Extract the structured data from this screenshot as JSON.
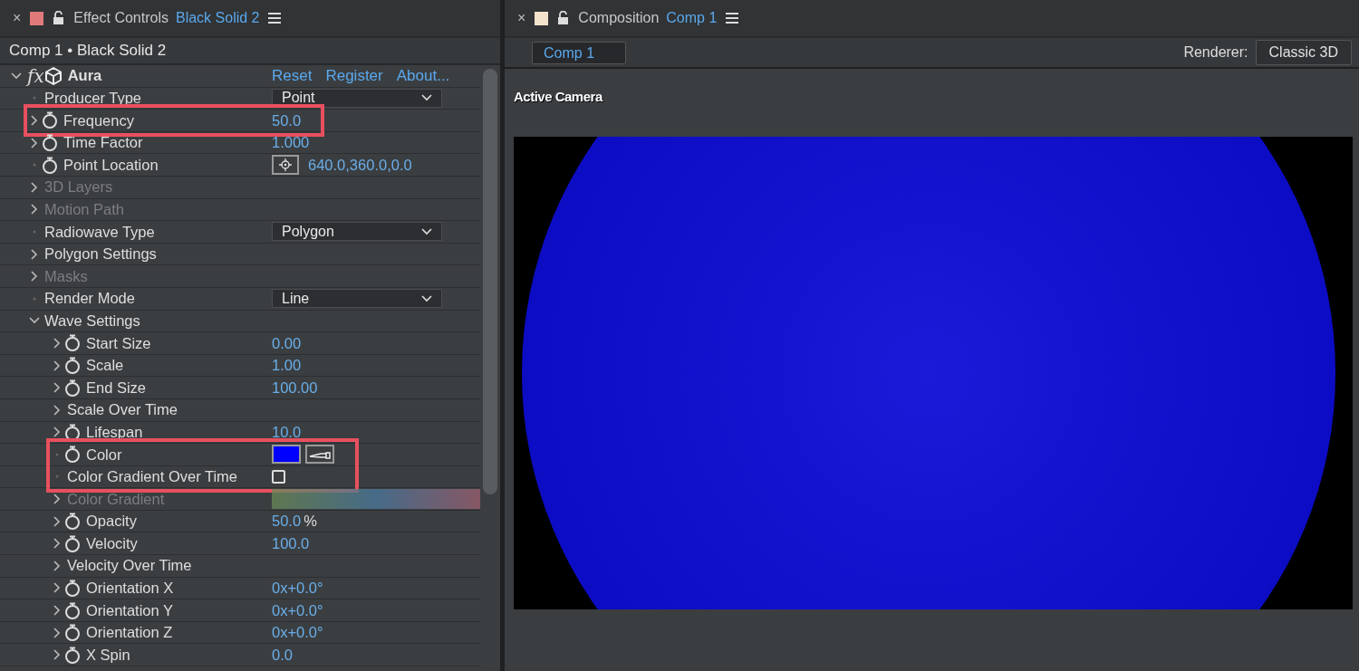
{
  "effect_panel": {
    "close": "×",
    "title": "Effect Controls",
    "layer": "Black Solid 2",
    "breadcrumb": "Comp 1 • Black Solid 2",
    "effect": {
      "badge": "fx",
      "name": "Aura",
      "expanded": true,
      "links": [
        "Reset",
        "Register",
        "About..."
      ],
      "params": [
        {
          "label": "Producer Type",
          "kind": "dropdown",
          "value": "Point",
          "expandable": false,
          "animatable": false,
          "disabled": false,
          "highlighted": false
        },
        {
          "label": "Frequency",
          "kind": "number",
          "value": "50.0",
          "expandable": true,
          "expanded": false,
          "animatable": true,
          "disabled": false,
          "highlighted": true
        },
        {
          "label": "Time Factor",
          "kind": "number",
          "value": "1.000",
          "expandable": true,
          "expanded": false,
          "animatable": true,
          "disabled": false,
          "highlighted": false
        },
        {
          "label": "Point Location",
          "kind": "point",
          "value": "640.0,360.0,0.0",
          "expandable": false,
          "animatable": true,
          "disabled": false,
          "highlighted": false
        },
        {
          "label": "3D Layers",
          "kind": "group",
          "expandable": true,
          "expanded": false,
          "animatable": false,
          "disabled": true,
          "highlighted": false
        },
        {
          "label": "Motion Path",
          "kind": "group",
          "expandable": true,
          "expanded": false,
          "animatable": false,
          "disabled": true,
          "highlighted": false
        },
        {
          "label": "Radiowave Type",
          "kind": "dropdown",
          "value": "Polygon",
          "expandable": false,
          "animatable": false,
          "disabled": false,
          "highlighted": false
        },
        {
          "label": "Polygon Settings",
          "kind": "group",
          "expandable": true,
          "expanded": false,
          "animatable": false,
          "disabled": false,
          "highlighted": false
        },
        {
          "label": "Masks",
          "kind": "group",
          "expandable": true,
          "expanded": false,
          "animatable": false,
          "disabled": true,
          "highlighted": false
        },
        {
          "label": "Render Mode",
          "kind": "dropdown",
          "value": "Line",
          "expandable": false,
          "animatable": false,
          "disabled": false,
          "highlighted": false
        },
        {
          "label": "Wave Settings",
          "kind": "group",
          "expandable": true,
          "expanded": true,
          "animatable": false,
          "disabled": false,
          "highlighted": false,
          "children": [
            {
              "label": "Start Size",
              "kind": "number",
              "value": "0.00",
              "expandable": true,
              "expanded": false,
              "animatable": true,
              "disabled": false,
              "highlighted": false
            },
            {
              "label": "Scale",
              "kind": "number",
              "value": "1.00",
              "expandable": true,
              "expanded": false,
              "animatable": true,
              "disabled": false,
              "highlighted": false
            },
            {
              "label": "End Size",
              "kind": "number",
              "value": "100.00",
              "expandable": true,
              "expanded": false,
              "animatable": true,
              "disabled": false,
              "highlighted": false
            },
            {
              "label": "Scale Over Time",
              "kind": "group",
              "expandable": true,
              "expanded": false,
              "animatable": false,
              "disabled": false,
              "highlighted": false
            },
            {
              "label": "Lifespan",
              "kind": "number",
              "value": "10.0",
              "expandable": true,
              "expanded": false,
              "animatable": true,
              "disabled": false,
              "highlighted": false
            },
            {
              "label": "Color",
              "kind": "color",
              "color": "#0000ff",
              "expandable": false,
              "animatable": true,
              "disabled": false,
              "highlighted": true
            },
            {
              "label": "Color Gradient Over Time",
              "kind": "checkbox",
              "checked": false,
              "expandable": false,
              "animatable": false,
              "disabled": false,
              "highlighted": true
            },
            {
              "label": "Color Gradient",
              "kind": "gradient",
              "expandable": true,
              "expanded": false,
              "animatable": false,
              "disabled": true,
              "highlighted": false
            },
            {
              "label": "Opacity",
              "kind": "number",
              "value": "50.0",
              "unit": "%",
              "expandable": true,
              "expanded": false,
              "animatable": true,
              "disabled": false,
              "highlighted": false
            },
            {
              "label": "Velocity",
              "kind": "number",
              "value": "100.0",
              "expandable": true,
              "expanded": false,
              "animatable": true,
              "disabled": false,
              "highlighted": false
            },
            {
              "label": "Velocity Over Time",
              "kind": "group",
              "expandable": true,
              "expanded": false,
              "animatable": false,
              "disabled": false,
              "highlighted": false
            },
            {
              "label": "Orientation X",
              "kind": "number",
              "value": "0x+0.0°",
              "expandable": true,
              "expanded": false,
              "animatable": true,
              "disabled": false,
              "highlighted": false
            },
            {
              "label": "Orientation Y",
              "kind": "number",
              "value": "0x+0.0°",
              "expandable": true,
              "expanded": false,
              "animatable": true,
              "disabled": false,
              "highlighted": false
            },
            {
              "label": "Orientation Z",
              "kind": "number",
              "value": "0x+0.0°",
              "expandable": true,
              "expanded": false,
              "animatable": true,
              "disabled": false,
              "highlighted": false
            },
            {
              "label": "X Spin",
              "kind": "number",
              "value": "0.0",
              "expandable": true,
              "expanded": false,
              "animatable": true,
              "disabled": false,
              "highlighted": false
            }
          ]
        }
      ]
    }
  },
  "composition_panel": {
    "close": "×",
    "title": "Composition",
    "comp": "Comp 1",
    "tabs": [
      {
        "label": "Comp 1",
        "selected": true
      }
    ],
    "renderer_label": "Renderer:",
    "renderer": "Classic 3D",
    "view_label": "Active Camera"
  }
}
